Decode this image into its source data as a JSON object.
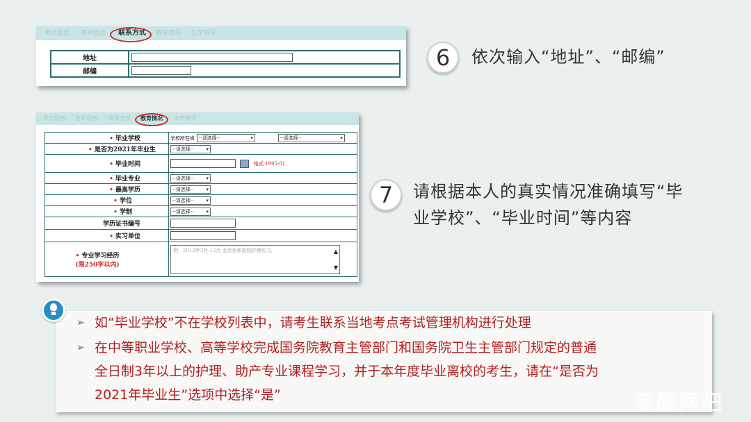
{
  "panel1": {
    "tabs": [
      "考点信息",
      "基本信息",
      "联系方式",
      "教育情况",
      "工作情况"
    ],
    "active_tab": "联系方式",
    "rows": [
      {
        "label": "地址"
      },
      {
        "label": "邮编"
      }
    ]
  },
  "panel2": {
    "tabs": [
      "考点信息",
      "基本信息",
      "联系方式",
      "教育情况",
      "工作情况"
    ],
    "active_tab": "教育情况",
    "school_prefix": "学校所在省",
    "select_placeholder": "--请选择--",
    "date_hint": "格式:1995-01",
    "textarea_placeholder": "例：2012年3月-12月 北京协和医院护理实习;",
    "rows": {
      "school": "毕业学校",
      "is_2021": "是否为2021年毕业生",
      "grad_time": "毕业时间",
      "major": "毕业专业",
      "edu": "最高学历",
      "degree": "学位",
      "system": "学制",
      "cert_no": "学历证书编号",
      "intern": "实习单位",
      "study": "专业学习经历",
      "study_limit": "(限250字以内)"
    }
  },
  "step6": {
    "num": "6",
    "text": "依次输入“地址”、“邮编”"
  },
  "step7": {
    "num": "7",
    "text_line1": "请根据本人的真实情况准确填写“毕",
    "text_line2": "业学校”、“毕业时间”等内容"
  },
  "notes": {
    "item1": "如“毕业学校”不在学校列表中，请考生联系当地考点考试管理机构进行处理",
    "item2_l1": "在中等职业学校、高等学校完成国务院教育主管部门和国务院卫生主管部门规定的普通",
    "item2_l2": "全日制3年以上的护理、助产专业课程学习，并于本年度毕业离校的考生，请在“是否为",
    "item2_l3": "2021年毕业生”选项中选择“是”"
  },
  "watermark": "氪服网吧",
  "colors": {
    "accent_red": "#cc2b2b",
    "tab_bar": "#c8e6e6",
    "border": "#2a7070"
  }
}
